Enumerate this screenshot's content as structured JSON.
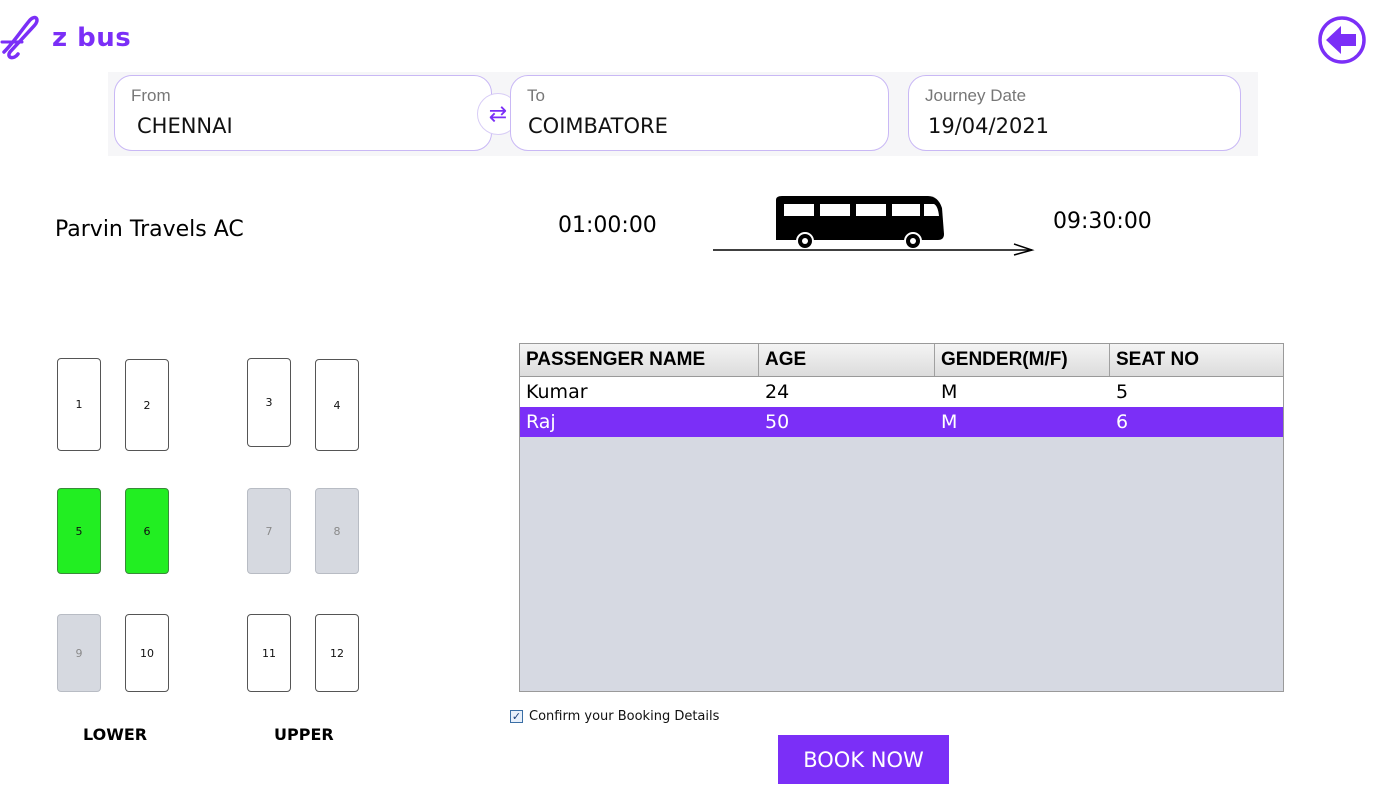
{
  "app": {
    "name": "z bus",
    "accent": "#7b2ff7"
  },
  "search": {
    "from_label": "From",
    "from_value": "CHENNAI",
    "to_label": "To",
    "to_value": "COIMBATORE",
    "date_label": "Journey Date",
    "date_value": "19/04/2021",
    "swap_icon": "swap-arrows-icon"
  },
  "trip": {
    "operator": "Parvin Travels AC",
    "departure": "01:00:00",
    "arrival": "09:30:00"
  },
  "seats": {
    "lower_label": "LOWER",
    "upper_label": "UPPER",
    "list": [
      {
        "no": "1",
        "state": "available"
      },
      {
        "no": "2",
        "state": "available"
      },
      {
        "no": "3",
        "state": "available"
      },
      {
        "no": "4",
        "state": "available"
      },
      {
        "no": "5",
        "state": "selected"
      },
      {
        "no": "6",
        "state": "selected"
      },
      {
        "no": "7",
        "state": "booked"
      },
      {
        "no": "8",
        "state": "booked"
      },
      {
        "no": "9",
        "state": "booked"
      },
      {
        "no": "10",
        "state": "available"
      },
      {
        "no": "11",
        "state": "available"
      },
      {
        "no": "12",
        "state": "available"
      }
    ],
    "colors": {
      "selected": "#22ee22",
      "booked": "#d6d9e0",
      "available": "#ffffff"
    }
  },
  "passengers": {
    "columns": [
      "PASSENGER NAME",
      "AGE",
      "GENDER(M/F)",
      "SEAT NO"
    ],
    "rows": [
      [
        "Kumar",
        "24",
        "M",
        "5"
      ],
      [
        "Raj",
        "50",
        "M",
        "6"
      ]
    ],
    "selected_row": 1
  },
  "confirm": {
    "label": "Confirm your Booking Details",
    "checked": true
  },
  "book_button": "BOOK NOW"
}
